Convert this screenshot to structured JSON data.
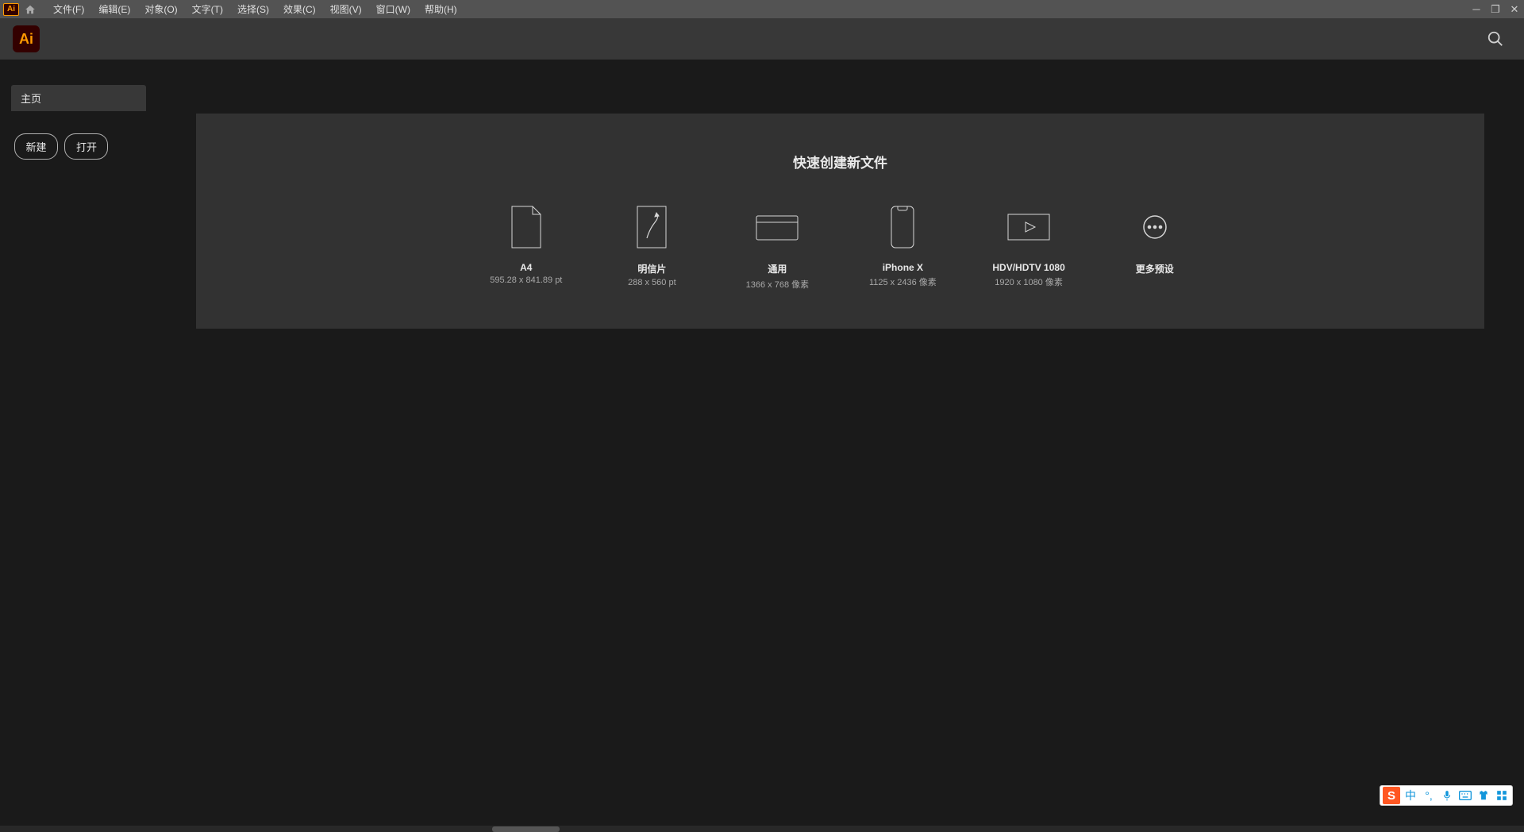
{
  "menubar": {
    "items": [
      "文件(F)",
      "编辑(E)",
      "对象(O)",
      "文字(T)",
      "选择(S)",
      "效果(C)",
      "视图(V)",
      "窗口(W)",
      "帮助(H)"
    ]
  },
  "app_logo_text": "Ai",
  "sidebar": {
    "home_tab": "主页",
    "new_btn": "新建",
    "open_btn": "打开"
  },
  "panel": {
    "title": "快速创建新文件",
    "presets": [
      {
        "name": "A4",
        "dim": "595.28 x 841.89 pt"
      },
      {
        "name": "明信片",
        "dim": "288 x 560 pt"
      },
      {
        "name": "通用",
        "dim": "1366 x 768 像素"
      },
      {
        "name": "iPhone X",
        "dim": "1125 x 2436 像素"
      },
      {
        "name": "HDV/HDTV 1080",
        "dim": "1920 x 1080 像素"
      },
      {
        "name": "更多预设",
        "dim": ""
      }
    ]
  },
  "ime": {
    "logo": "S",
    "lang": "中"
  }
}
